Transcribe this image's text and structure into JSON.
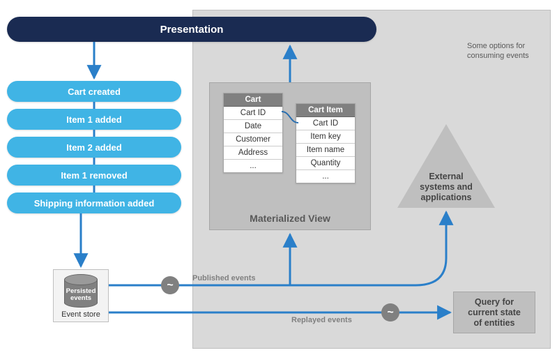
{
  "presentation_label": "Presentation",
  "events": [
    "Cart created",
    "Item 1 added",
    "Item 2 added",
    "Item 1 removed",
    "Shipping information added"
  ],
  "note_line1": "Some options for",
  "note_line2": "consuming events",
  "materialized_view": {
    "title": "Materialized View",
    "cart_table": {
      "header": "Cart",
      "rows": [
        "Cart ID",
        "Date",
        "Customer",
        "Address",
        "..."
      ]
    },
    "cart_item_table": {
      "header": "Cart Item",
      "rows": [
        "Cart ID",
        "Item key",
        "Item name",
        "Quantity",
        "..."
      ]
    }
  },
  "event_store": {
    "cylinder_label_l1": "Persisted",
    "cylinder_label_l2": "events",
    "caption": "Event store"
  },
  "external": {
    "l1": "External",
    "l2": "systems and",
    "l3": "applications"
  },
  "query": {
    "l1": "Query for",
    "l2": "current state",
    "l3": "of entities"
  },
  "connector_labels": {
    "published": "Published events",
    "replayed": "Replayed events"
  },
  "chart_data": {
    "type": "diagram",
    "title": "Event Sourcing pattern overview",
    "nodes": [
      {
        "id": "presentation",
        "label": "Presentation"
      },
      {
        "id": "evt_cart_created",
        "label": "Cart created",
        "group": "event-stream"
      },
      {
        "id": "evt_item1_added",
        "label": "Item 1 added",
        "group": "event-stream"
      },
      {
        "id": "evt_item2_added",
        "label": "Item 2 added",
        "group": "event-stream"
      },
      {
        "id": "evt_item1_removed",
        "label": "Item 1 removed",
        "group": "event-stream"
      },
      {
        "id": "evt_shipping_added",
        "label": "Shipping information added",
        "group": "event-stream"
      },
      {
        "id": "event_store",
        "label": "Event store (Persisted events)"
      },
      {
        "id": "materialized_view",
        "label": "Materialized View",
        "contains": [
          "Cart table",
          "Cart Item table"
        ]
      },
      {
        "id": "external",
        "label": "External systems and applications"
      },
      {
        "id": "query",
        "label": "Query for current state of entities"
      }
    ],
    "edges": [
      {
        "from": "presentation",
        "to": "event-stream"
      },
      {
        "from": "event-stream",
        "to": "event_store"
      },
      {
        "from": "event_store",
        "to": "materialized_view",
        "label": "Published events"
      },
      {
        "from": "event_store",
        "to": "external",
        "label": "Published events"
      },
      {
        "from": "event_store",
        "to": "query",
        "label": "Replayed events"
      },
      {
        "from": "materialized_view",
        "to": "presentation"
      }
    ],
    "tables": {
      "Cart": [
        "Cart ID",
        "Date",
        "Customer",
        "Address",
        "..."
      ],
      "Cart Item": [
        "Cart ID",
        "Item key",
        "Item name",
        "Quantity",
        "..."
      ]
    },
    "annotation": "Some options for consuming events"
  }
}
